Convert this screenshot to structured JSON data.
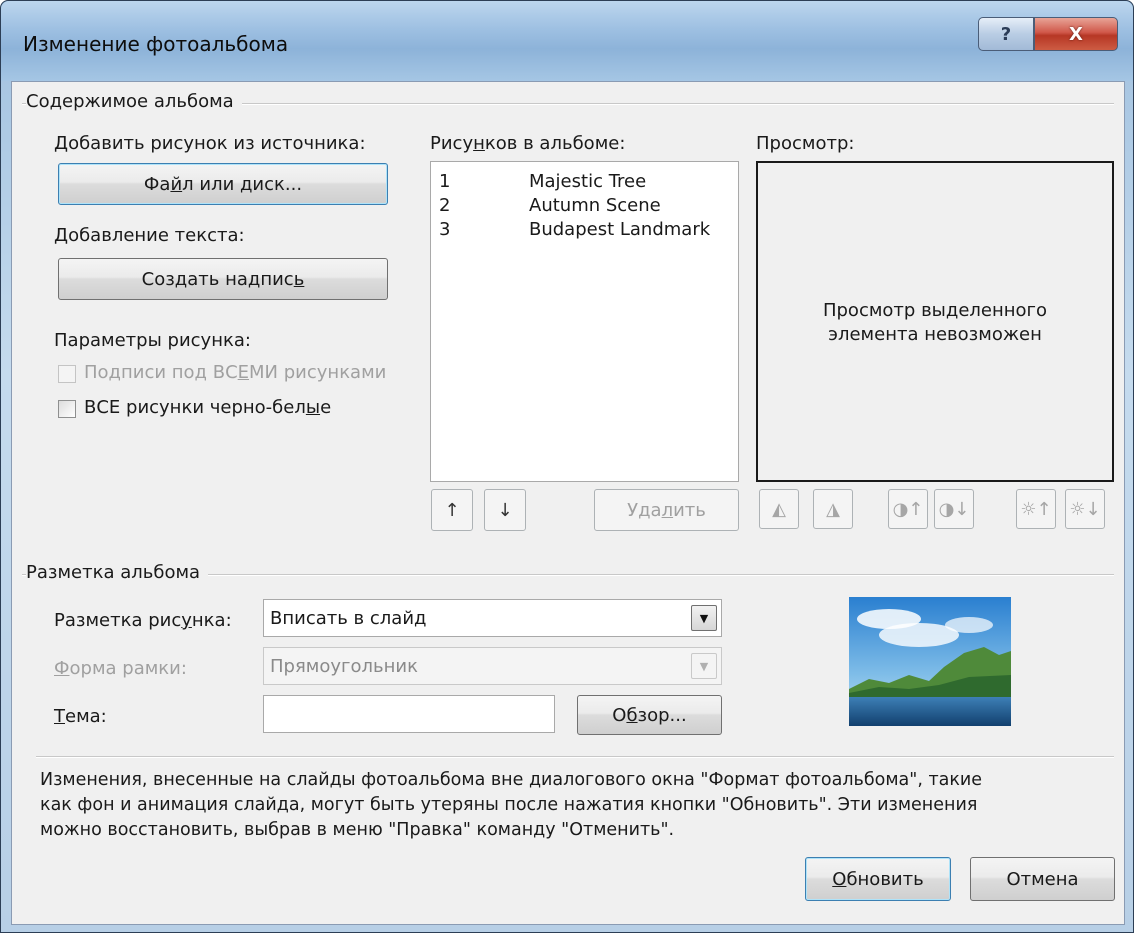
{
  "window": {
    "title": "Изменение фотоальбома",
    "help_label": "?",
    "close_label": "X"
  },
  "album_content": {
    "group_label": "Содержимое альбома",
    "add_from_label": "Добавить рисунок из источника:",
    "file_button": {
      "pre": "Фа",
      "u": "й",
      "post": "л или диск..."
    },
    "add_text_label": "Добавление текста:",
    "new_textbox_button": {
      "pre": "Создать надпис",
      "u": "ь",
      "post": ""
    },
    "picture_options_label": "Параметры рисунка:",
    "captions_checkbox": {
      "pre": "Подписи под ВС",
      "u": "Е",
      "post": "МИ рисунками",
      "checked": false,
      "enabled": false
    },
    "bw_checkbox": {
      "pre": "ВСЕ рисунки черно-бел",
      "u": "ы",
      "post": "е",
      "checked": false,
      "enabled": true
    }
  },
  "pictures_list": {
    "label": {
      "pre": "Рису",
      "u": "н",
      "post": "ков в альбоме:"
    },
    "items": [
      {
        "num": "1",
        "name": "Majestic Tree"
      },
      {
        "num": "2",
        "name": "Autumn Scene"
      },
      {
        "num": "3",
        "name": "Budapest Landmark"
      }
    ],
    "move_up_glyph": "↑",
    "move_down_glyph": "↓",
    "remove_button": {
      "pre": "Уда",
      "u": "л",
      "post": "ить"
    }
  },
  "preview": {
    "label": "Просмотр:",
    "message_line1": "Просмотр выделенного",
    "message_line2": "элемента невозможен",
    "tools": [
      {
        "name": "rotate-left-icon",
        "glyph": "◭"
      },
      {
        "name": "rotate-right-icon",
        "glyph": "◮"
      },
      {
        "name": "contrast-up-icon",
        "glyph": "◑↑"
      },
      {
        "name": "contrast-down-icon",
        "glyph": "◑↓"
      },
      {
        "name": "brightness-up-icon",
        "glyph": "☼↑"
      },
      {
        "name": "brightness-down-icon",
        "glyph": "☼↓"
      }
    ]
  },
  "album_layout": {
    "group_label": "Разметка альбома",
    "picture_layout_label": {
      "pre": "Разметка рис",
      "u": "у",
      "post": "нка:"
    },
    "picture_layout_value": "Вписать в слайд",
    "frame_shape_label": {
      "pre": "",
      "u": "Ф",
      "post": "орма рамки:"
    },
    "frame_shape_value": "Прямоугольник",
    "theme_label": {
      "pre": "",
      "u": "Т",
      "post": "ема:"
    },
    "theme_value": "",
    "browse_button": {
      "pre": "О",
      "u": "б",
      "post": "зор..."
    }
  },
  "note": {
    "line1": "Изменения, внесенные на слайды фотоальбома вне диалогового окна \"Формат фотоальбома\", такие",
    "line2": "как фон и анимация слайда, могут быть утеряны после нажатия кнопки \"Обновить\". Эти изменения",
    "line3": "можно восстановить, выбрав в меню \"Правка\" команду \"Отменить\"."
  },
  "footer": {
    "update_button": {
      "pre": "",
      "u": "О",
      "post": "бновить"
    },
    "cancel_button": "Отмена"
  },
  "colors": {
    "title_bar": "#9ec0e2",
    "close_button": "#c9443a",
    "dialog_face": "#f0f0f0"
  }
}
